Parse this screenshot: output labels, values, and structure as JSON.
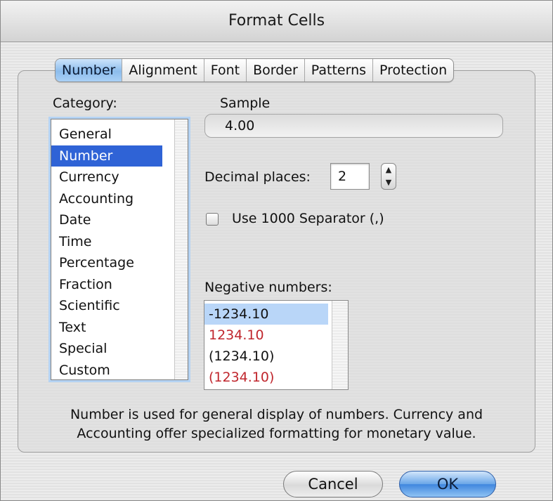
{
  "window": {
    "title": "Format Cells"
  },
  "tabs": [
    {
      "label": "Number",
      "active": true
    },
    {
      "label": "Alignment",
      "active": false
    },
    {
      "label": "Font",
      "active": false
    },
    {
      "label": "Border",
      "active": false
    },
    {
      "label": "Patterns",
      "active": false
    },
    {
      "label": "Protection",
      "active": false
    }
  ],
  "category": {
    "label": "Category:",
    "items": [
      "General",
      "Number",
      "Currency",
      "Accounting",
      "Date",
      "Time",
      "Percentage",
      "Fraction",
      "Scientific",
      "Text",
      "Special",
      "Custom"
    ],
    "selected": "Number"
  },
  "sample": {
    "label": "Sample",
    "value": "4.00"
  },
  "decimal_places": {
    "label": "Decimal places:",
    "value": "2"
  },
  "separator": {
    "label": "Use 1000 Separator (,)",
    "checked": false
  },
  "negative_numbers": {
    "label": "Negative numbers:",
    "items": [
      {
        "text": "-1234.10",
        "color": "#111111",
        "selected": true
      },
      {
        "text": "1234.10",
        "color": "#c0262d",
        "selected": false
      },
      {
        "text": "(1234.10)",
        "color": "#111111",
        "selected": false
      },
      {
        "text": "(1234.10)",
        "color": "#c0262d",
        "selected": false
      }
    ]
  },
  "description": {
    "line1": "Number is used for general display of numbers.  Currency and",
    "line2": "Accounting offer specialized formatting for monetary value."
  },
  "buttons": {
    "cancel": "Cancel",
    "ok": "OK"
  },
  "colors": {
    "selection": "#2f63d6",
    "accent": "#3f86de",
    "negative_red": "#c0262d"
  }
}
